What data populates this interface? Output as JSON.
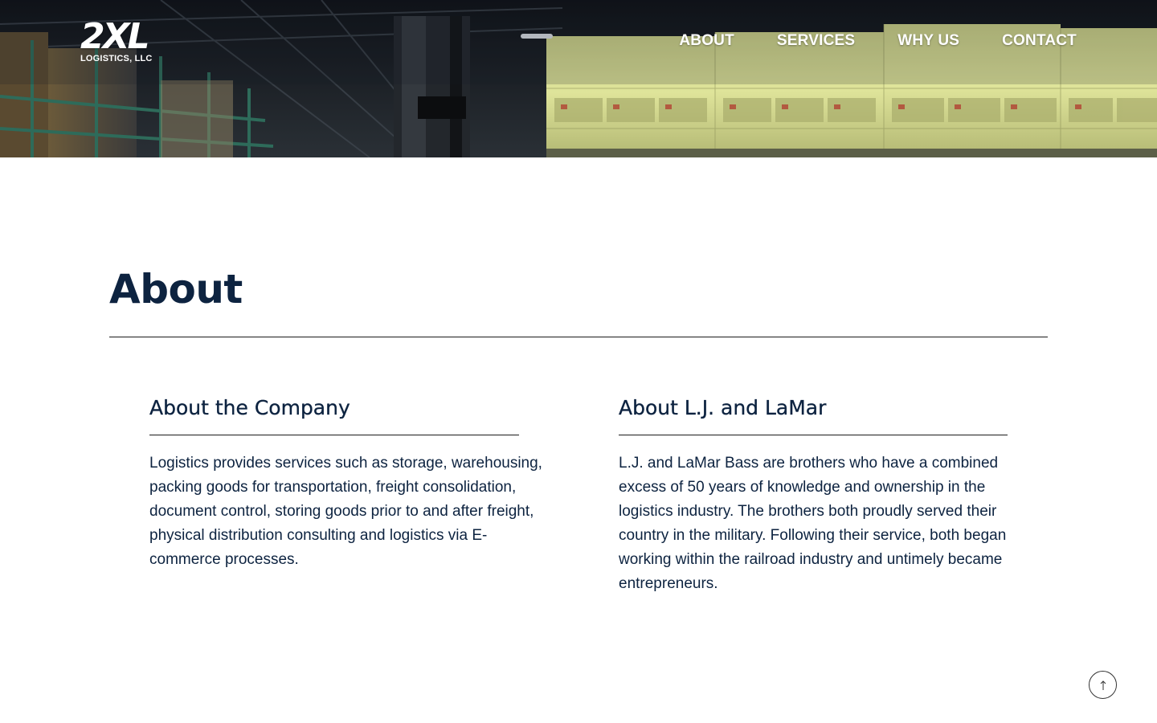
{
  "header": {
    "logo": {
      "mark": "2XL",
      "subtitle": "LOGISTICS, LLC"
    },
    "nav": [
      {
        "label": "ABOUT"
      },
      {
        "label": "SERVICES"
      },
      {
        "label": "WHY US"
      },
      {
        "label": "CONTACT"
      }
    ]
  },
  "main": {
    "title": "About",
    "company": {
      "heading": "About the Company",
      "body": "Logistics provides services such as storage, warehousing, packing goods for transportation, freight consolidation, document control, storing goods prior to and after freight, physical distribution consulting and logistics via E-commerce processes."
    },
    "founders": {
      "heading": "About L.J. and LaMar",
      "body": "L.J. and LaMar Bass are brothers who have a combined excess of 50 years of knowledge and ownership in the logistics industry. The brothers both proudly served their country in the military. Following their service, both began working within the railroad industry and untimely became entrepreneurs."
    }
  },
  "colors": {
    "navy": "#0d2340",
    "rule": "#1a1a1a",
    "pallet_wrap": "#d9df8a"
  },
  "icons": {
    "back_to_top": "arrow-up-icon"
  }
}
